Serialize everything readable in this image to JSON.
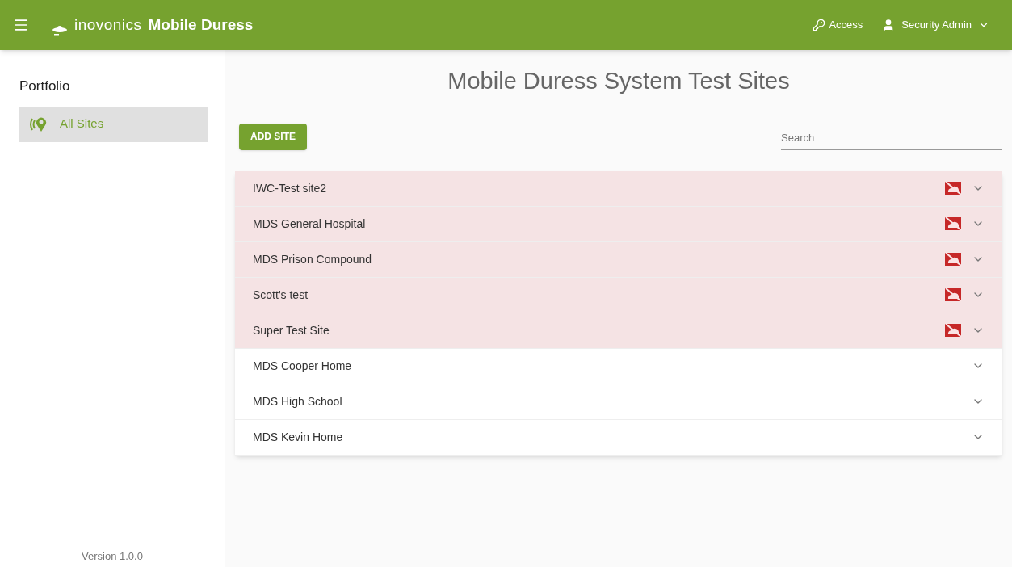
{
  "header": {
    "brand": "inovonics",
    "title": "Mobile Duress",
    "access": "Access",
    "user": "Security Admin"
  },
  "sidebar": {
    "heading": "Portfolio",
    "items": [
      {
        "label": "All Sites",
        "selected": true
      }
    ],
    "version": "Version 1.0.0"
  },
  "page_title": "Mobile Duress System Test Sites",
  "add_button": "ADD SITE",
  "search": {
    "placeholder": "Search"
  },
  "sites": [
    {
      "name": "IWC-Test site2",
      "alert": true
    },
    {
      "name": "MDS General Hospital",
      "alert": true
    },
    {
      "name": "MDS Prison Compound",
      "alert": true
    },
    {
      "name": "Scott's test",
      "alert": true
    },
    {
      "name": "Super Test Site",
      "alert": true
    },
    {
      "name": "MDS Cooper Home",
      "alert": false
    },
    {
      "name": "MDS High School",
      "alert": false
    },
    {
      "name": "MDS Kevin Home",
      "alert": false
    }
  ]
}
